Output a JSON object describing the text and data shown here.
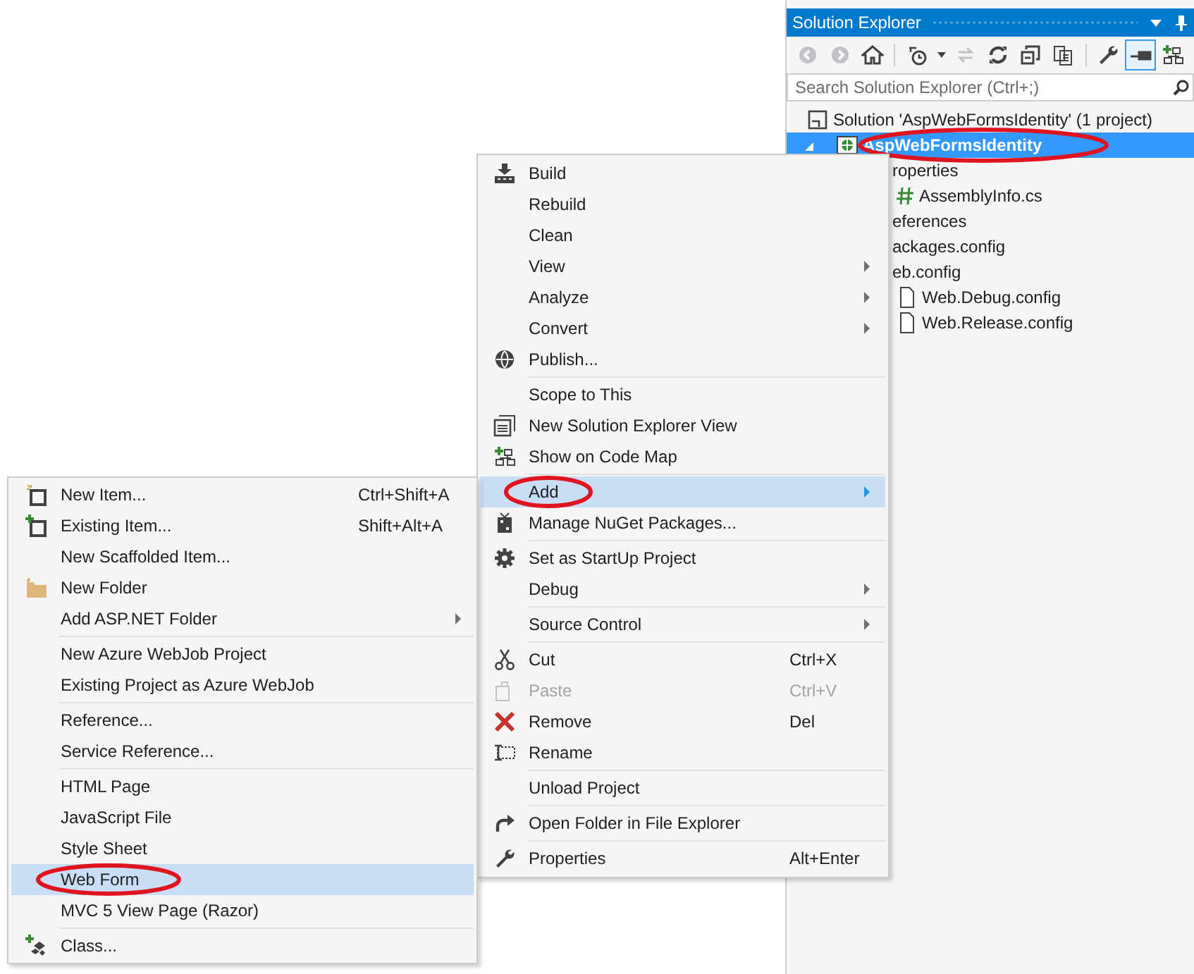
{
  "solution_explorer": {
    "title": "Solution Explorer",
    "toolbar_groups": [
      [
        {
          "disabled": true,
          "pressed": false
        },
        {
          "disabled": true,
          "pressed": false
        },
        {
          "disabled": false,
          "pressed": false
        }
      ],
      [
        {
          "disabled": false,
          "pressed": false
        },
        {
          "disabled": true,
          "pressed": false
        },
        {
          "disabled": false,
          "pressed": false
        },
        {
          "disabled": false,
          "pressed": false
        },
        {
          "disabled": false,
          "pressed": false
        }
      ],
      [
        {
          "disabled": false,
          "pressed": false
        },
        {
          "disabled": false,
          "pressed": true
        },
        {
          "disabled": false,
          "pressed": false
        }
      ]
    ],
    "search": {
      "placeholder": "Search Solution Explorer (Ctrl+;)"
    },
    "tree": [
      {
        "label": "Solution 'AspWebFormsIdentity' (1 project)",
        "selected": false,
        "circled": false,
        "children": [
          {
            "label": "AspWebFormsIdentity",
            "selected": true,
            "circled": true,
            "expanded": true,
            "children": [
              {
                "label": "roperties",
                "selected": false,
                "circled": false,
                "children": [
                  {
                    "label": "AssemblyInfo.cs",
                    "selected": false,
                    "circled": false
                  }
                ]
              },
              {
                "label": "eferences",
                "selected": false,
                "circled": false
              },
              {
                "label": "ackages.config",
                "selected": false,
                "circled": false
              },
              {
                "label": "eb.config",
                "selected": false,
                "circled": false,
                "children": [
                  {
                    "label": "Web.Debug.config",
                    "selected": false,
                    "circled": false
                  },
                  {
                    "label": "Web.Release.config",
                    "selected": false,
                    "circled": false
                  }
                ]
              }
            ]
          }
        ]
      }
    ]
  },
  "context_menu": {
    "groups": [
      [
        {
          "label": "Build",
          "submenu": false,
          "selected": false,
          "disabled": false,
          "circled": false
        },
        {
          "label": "Rebuild",
          "submenu": false,
          "selected": false,
          "disabled": false,
          "circled": false
        },
        {
          "label": "Clean",
          "submenu": false,
          "selected": false,
          "disabled": false,
          "circled": false
        },
        {
          "label": "View",
          "submenu": true,
          "selected": false,
          "disabled": false,
          "circled": false
        },
        {
          "label": "Analyze",
          "submenu": true,
          "selected": false,
          "disabled": false,
          "circled": false
        },
        {
          "label": "Convert",
          "submenu": true,
          "selected": false,
          "disabled": false,
          "circled": false
        },
        {
          "label": "Publish...",
          "submenu": false,
          "selected": false,
          "disabled": false,
          "circled": false
        }
      ],
      [
        {
          "label": "Scope to This",
          "submenu": false,
          "selected": false,
          "disabled": false,
          "circled": false
        },
        {
          "label": "New Solution Explorer View",
          "submenu": false,
          "selected": false,
          "disabled": false,
          "circled": false
        },
        {
          "label": "Show on Code Map",
          "submenu": false,
          "selected": false,
          "disabled": false,
          "circled": false
        }
      ],
      [
        {
          "label": "Add",
          "submenu": true,
          "selected": true,
          "disabled": false,
          "circled": true
        },
        {
          "label": "Manage NuGet Packages...",
          "submenu": false,
          "selected": false,
          "disabled": false,
          "circled": false
        }
      ],
      [
        {
          "label": "Set as StartUp Project",
          "submenu": false,
          "selected": false,
          "disabled": false,
          "circled": false
        },
        {
          "label": "Debug",
          "submenu": true,
          "selected": false,
          "disabled": false,
          "circled": false
        }
      ],
      [
        {
          "label": "Source Control",
          "submenu": true,
          "selected": false,
          "disabled": false,
          "circled": false
        }
      ],
      [
        {
          "label": "Cut",
          "shortcut": "Ctrl+X",
          "submenu": false,
          "selected": false,
          "disabled": false,
          "circled": false
        },
        {
          "label": "Paste",
          "shortcut": "Ctrl+V",
          "submenu": false,
          "selected": false,
          "disabled": true,
          "circled": false
        },
        {
          "label": "Remove",
          "shortcut": "Del",
          "submenu": false,
          "selected": false,
          "disabled": false,
          "circled": false
        },
        {
          "label": "Rename",
          "submenu": false,
          "selected": false,
          "disabled": false,
          "circled": false
        }
      ],
      [
        {
          "label": "Unload Project",
          "submenu": false,
          "selected": false,
          "disabled": false,
          "circled": false
        }
      ],
      [
        {
          "label": "Open Folder in File Explorer",
          "submenu": false,
          "selected": false,
          "disabled": false,
          "circled": false
        }
      ],
      [
        {
          "label": "Properties",
          "shortcut": "Alt+Enter",
          "submenu": false,
          "selected": false,
          "disabled": false,
          "circled": false
        }
      ]
    ]
  },
  "add_submenu": {
    "groups": [
      [
        {
          "label": "New Item...",
          "shortcut": "Ctrl+Shift+A",
          "submenu": false,
          "selected": false,
          "disabled": false,
          "circled": false
        },
        {
          "label": "Existing Item...",
          "shortcut": "Shift+Alt+A",
          "submenu": false,
          "selected": false,
          "disabled": false,
          "circled": false
        },
        {
          "label": "New Scaffolded Item...",
          "submenu": false,
          "selected": false,
          "disabled": false,
          "circled": false
        },
        {
          "label": "New Folder",
          "submenu": false,
          "selected": false,
          "disabled": false,
          "circled": false
        },
        {
          "label": "Add ASP.NET Folder",
          "submenu": true,
          "selected": false,
          "disabled": false,
          "circled": false
        }
      ],
      [
        {
          "label": "New Azure WebJob Project",
          "submenu": false,
          "selected": false,
          "disabled": false,
          "circled": false
        },
        {
          "label": "Existing Project as Azure WebJob",
          "submenu": false,
          "selected": false,
          "disabled": false,
          "circled": false
        }
      ],
      [
        {
          "label": "Reference...",
          "submenu": false,
          "selected": false,
          "disabled": false,
          "circled": false
        },
        {
          "label": "Service Reference...",
          "submenu": false,
          "selected": false,
          "disabled": false,
          "circled": false
        }
      ],
      [
        {
          "label": "HTML Page",
          "submenu": false,
          "selected": false,
          "disabled": false,
          "circled": false
        },
        {
          "label": "JavaScript File",
          "submenu": false,
          "selected": false,
          "disabled": false,
          "circled": false
        },
        {
          "label": "Style Sheet",
          "submenu": false,
          "selected": false,
          "disabled": false,
          "circled": false
        },
        {
          "label": "Web Form",
          "submenu": false,
          "selected": true,
          "disabled": false,
          "circled": true
        },
        {
          "label": "MVC 5 View Page (Razor)",
          "submenu": false,
          "selected": false,
          "disabled": false,
          "circled": false
        }
      ],
      [
        {
          "label": "Class...",
          "submenu": false,
          "selected": false,
          "disabled": false,
          "circled": false
        }
      ]
    ]
  }
}
